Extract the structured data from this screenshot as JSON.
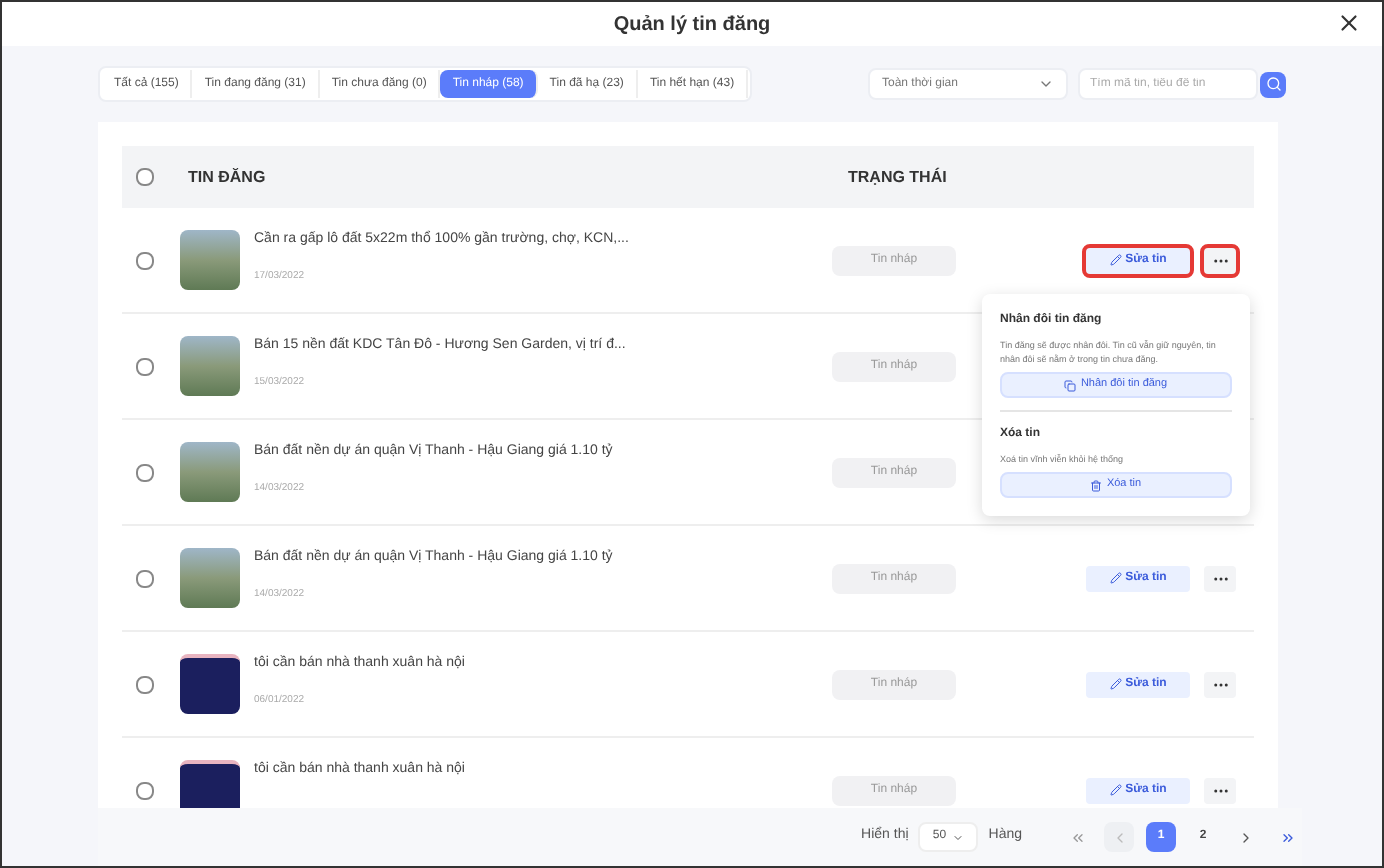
{
  "window": {
    "title": "Quản lý tin đăng"
  },
  "tabs": [
    {
      "label": "Tất cả (155)",
      "selected": false
    },
    {
      "label": "Tin đang đăng (31)",
      "selected": false
    },
    {
      "label": "Tin chưa đăng (0)",
      "selected": false
    },
    {
      "label": "Tin nháp (58)",
      "selected": true
    },
    {
      "label": "Tin đã hạ (23)",
      "selected": false
    },
    {
      "label": "Tin hết hạn (43)",
      "selected": false
    }
  ],
  "time_filter": {
    "value": "Toàn thời gian"
  },
  "search": {
    "placeholder": "Tìm mã tin, tiêu đề tin"
  },
  "table": {
    "columns": [
      "TIN ĐĂNG",
      "TRẠNG THÁI"
    ],
    "all_checked": false,
    "rows": [
      {
        "kind": "photo",
        "title": "Cần ra gấp lô đất 5x22m thổ 100% gần trường, chợ, KCN,...",
        "date": "17/03/2022",
        "status": "Tin nháp",
        "checked": false,
        "edit": "Sửa tin",
        "highlighted": true
      },
      {
        "kind": "photo",
        "title": "Bán 15 nền đất KDC Tân Đô - Hương Sen Garden, vị trí đ...",
        "date": "15/03/2022",
        "status": "Tin nháp",
        "checked": false
      },
      {
        "kind": "photo",
        "title": "Bán đất nền dự án quận Vị Thanh - Hậu Giang giá 1.10 tỷ",
        "date": "14/03/2022",
        "status": "Tin nháp",
        "checked": false
      },
      {
        "kind": "photo",
        "title": "Bán đất nền dự án quận Vị Thanh - Hậu Giang giá 1.10 tỷ",
        "date": "14/03/2022",
        "status": "Tin nháp",
        "checked": false,
        "edit": "Sửa tin",
        "highlighted": false
      },
      {
        "kind": "screenshot",
        "title": "tôi cần bán nhà thanh xuân hà nội",
        "date": "06/01/2022",
        "status": "Tin nháp",
        "checked": false,
        "edit": "Sửa tin",
        "highlighted": false
      },
      {
        "kind": "screenshot",
        "title": "tôi cần bán nhà thanh xuân hà nội",
        "status": "Tin nháp",
        "checked": false,
        "edit": "Sửa tin",
        "highlighted": false
      }
    ]
  },
  "popup": {
    "sections": [
      {
        "heading": "Nhân đôi tin đăng",
        "text": "Tin đăng sẽ được nhân đôi. Tin cũ vẫn giữ nguyên, tin nhân đôi sẽ nằm ở trong tin chưa đăng.",
        "button": "Nhân đôi tin đăng",
        "kind": "copy"
      },
      {
        "heading": "Xóa tin",
        "text": "Xoá tin vĩnh viễn khỏi hệ thống",
        "button": "Xóa tin",
        "kind": "delete"
      }
    ]
  },
  "pagination": {
    "show_label": "Hiển thị",
    "page_size": "50",
    "rows_label": "Hàng",
    "pages": [
      {
        "label": "1",
        "selected": true
      },
      {
        "label": "2",
        "selected": false
      }
    ]
  }
}
